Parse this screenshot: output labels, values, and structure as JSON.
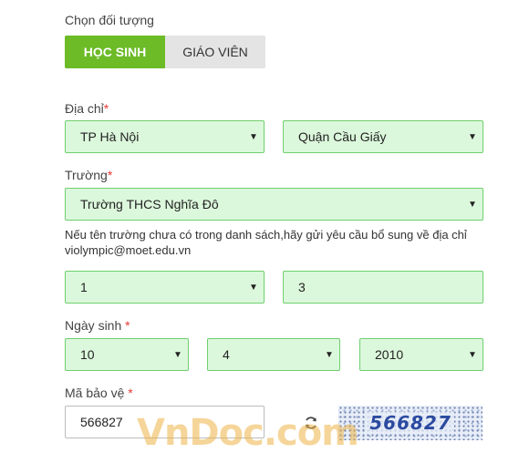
{
  "object_section": {
    "label": "Chọn đối tượng",
    "options": [
      {
        "label": "HỌC SINH",
        "active": true
      },
      {
        "label": "GIÁO VIÊN",
        "active": false
      }
    ]
  },
  "address": {
    "label": "Địa chỉ",
    "required_mark": "*",
    "province": "TP Hà Nội",
    "district": "Quận Cầu Giấy"
  },
  "school": {
    "label": "Trường",
    "required_mark": "*",
    "value": "Trường THCS Nghĩa Đô",
    "note": "Nếu tên trường chưa có trong danh sách,hãy gửi yêu cầu bổ sung về địa chỉ violympic@moet.edu.vn"
  },
  "grade_class": {
    "grade": "1",
    "class": "3"
  },
  "birthday": {
    "label": "Ngày sinh",
    "required_mark": "*",
    "day": "10",
    "month": "4",
    "year": "2010"
  },
  "captcha": {
    "label": "Mã bảo vệ",
    "required_mark": "*",
    "input_value": "566827",
    "image_text": "566827"
  },
  "watermark": "VnDoc.com",
  "icons": {
    "dropdown": "chevron-down-icon",
    "refresh": "refresh-icon"
  },
  "colors": {
    "accent_green": "#6cbb27",
    "field_bg": "#dcf8dc",
    "field_border": "#6fcf6f",
    "required": "#e53935"
  }
}
